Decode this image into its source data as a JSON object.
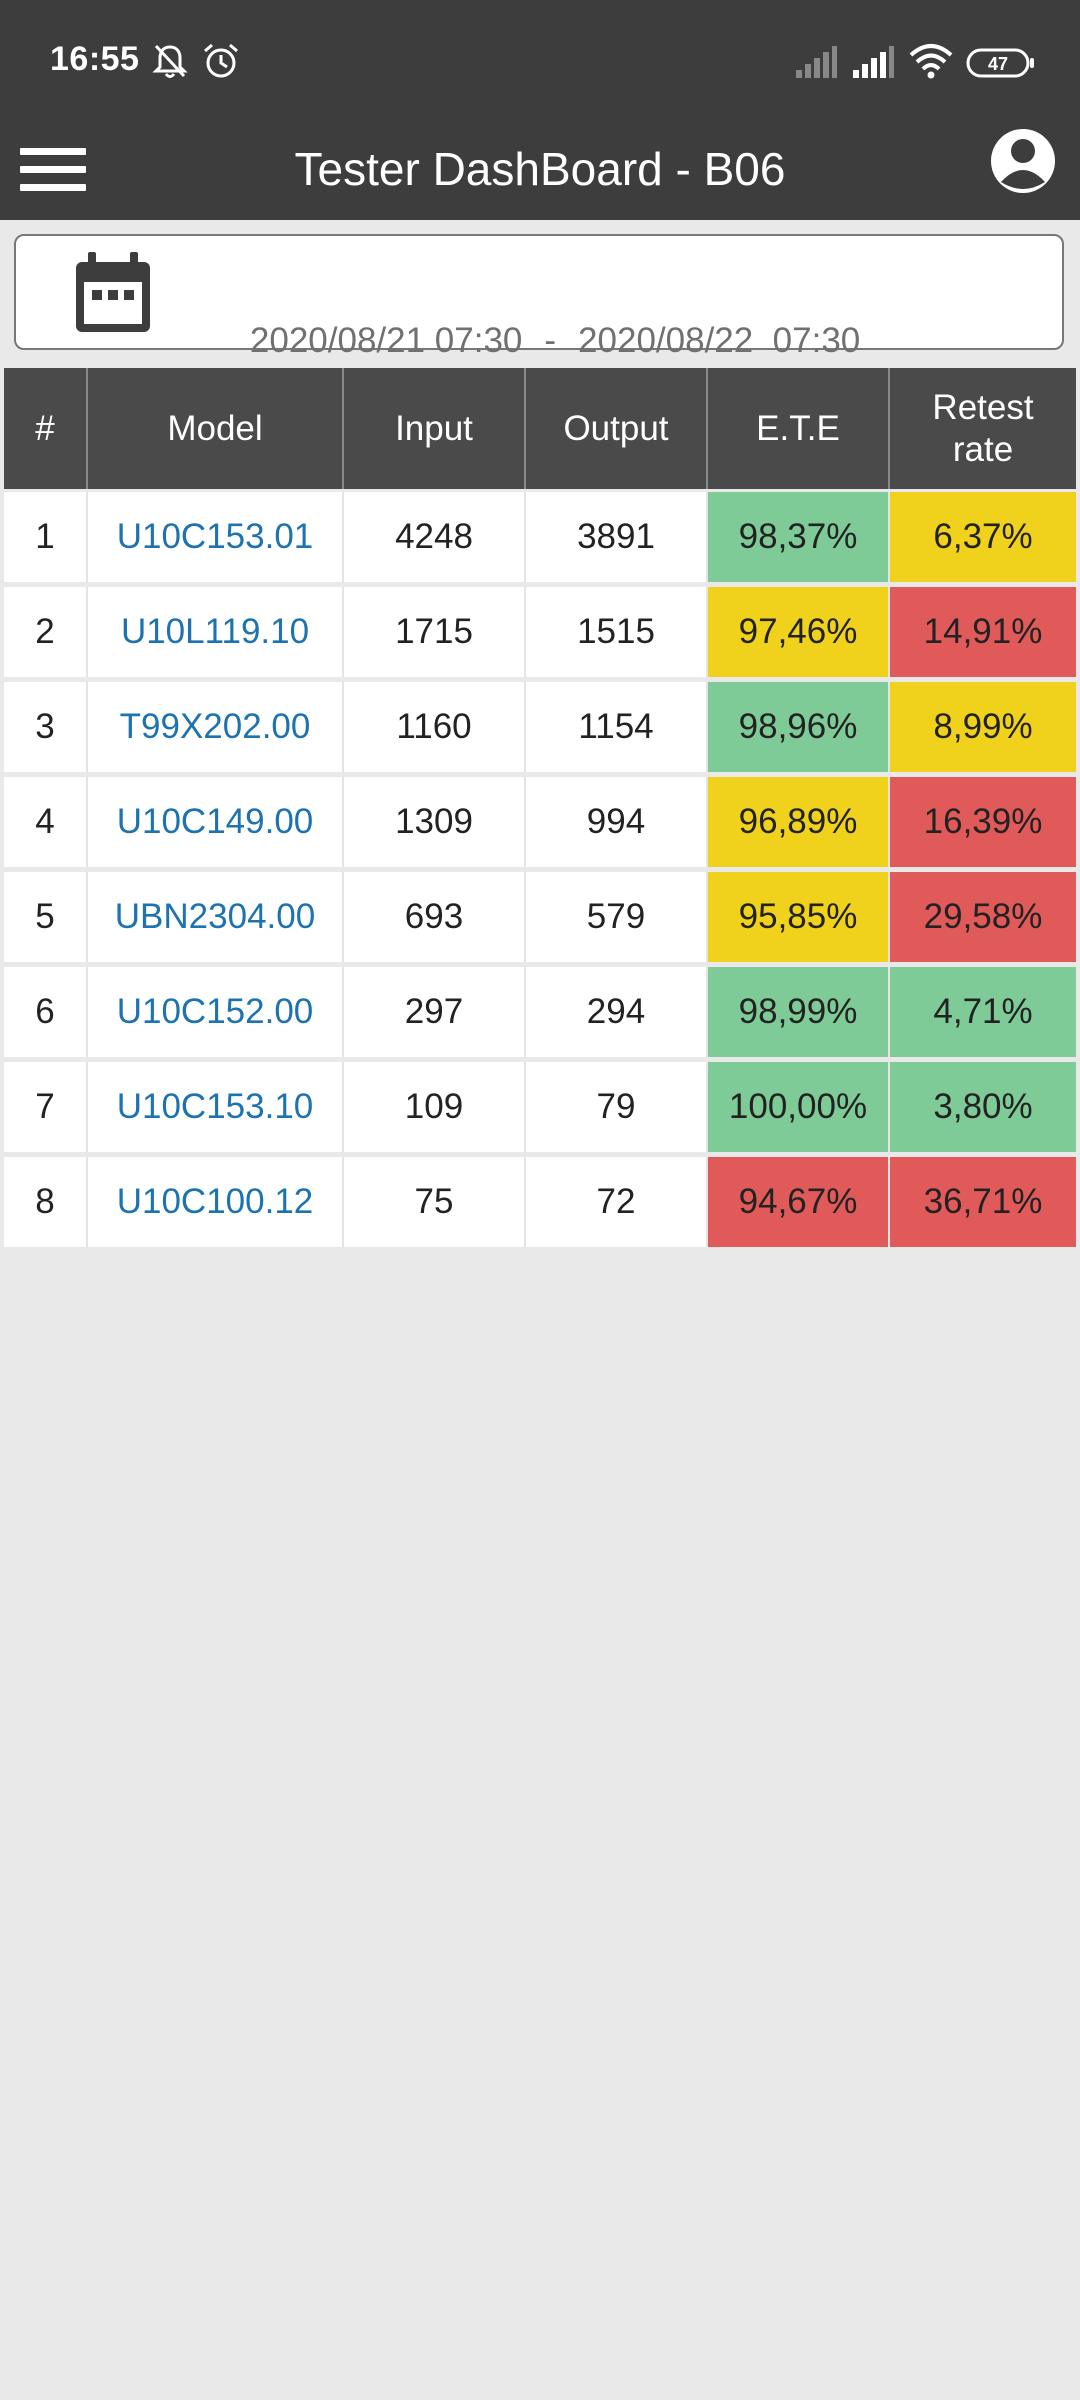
{
  "status_bar": {
    "time": "16:55",
    "battery": "47",
    "icons": [
      "bell-off-icon",
      "alarm-icon",
      "signal-icon",
      "signal-icon",
      "wifi-icon",
      "battery-icon"
    ]
  },
  "app_bar": {
    "title": "Tester DashBoard - B06",
    "menu_icon": "hamburger-icon",
    "profile_icon": "account-icon"
  },
  "date_range": {
    "icon": "calendar-icon",
    "start": "2020/08/21 07:30",
    "separator": "-",
    "end": "2020/08/22  07:30"
  },
  "table": {
    "headers": [
      "#",
      "Model",
      "Input",
      "Output",
      "E.T.E",
      "Retest\nrate"
    ],
    "rows": [
      {
        "no": "1",
        "model": "U10C153.01",
        "input": "4248",
        "output": "3891",
        "ete": "98,37%",
        "ete_status": "green",
        "retest": "6,37%",
        "retest_status": "yellow"
      },
      {
        "no": "2",
        "model": "U10L119.10",
        "input": "1715",
        "output": "1515",
        "ete": "97,46%",
        "ete_status": "yellow",
        "retest": "14,91%",
        "retest_status": "red"
      },
      {
        "no": "3",
        "model": "T99X202.00",
        "input": "1160",
        "output": "1154",
        "ete": "98,96%",
        "ete_status": "green",
        "retest": "8,99%",
        "retest_status": "yellow"
      },
      {
        "no": "4",
        "model": "U10C149.00",
        "input": "1309",
        "output": "994",
        "ete": "96,89%",
        "ete_status": "yellow",
        "retest": "16,39%",
        "retest_status": "red"
      },
      {
        "no": "5",
        "model": "UBN2304.00",
        "input": "693",
        "output": "579",
        "ete": "95,85%",
        "ete_status": "yellow",
        "retest": "29,58%",
        "retest_status": "red"
      },
      {
        "no": "6",
        "model": "U10C152.00",
        "input": "297",
        "output": "294",
        "ete": "98,99%",
        "ete_status": "green",
        "retest": "4,71%",
        "retest_status": "green"
      },
      {
        "no": "7",
        "model": "U10C153.10",
        "input": "109",
        "output": "79",
        "ete": "100,00%",
        "ete_status": "green",
        "retest": "3,80%",
        "retest_status": "green"
      },
      {
        "no": "8",
        "model": "U10C100.12",
        "input": "75",
        "output": "72",
        "ete": "94,67%",
        "ete_status": "red",
        "retest": "36,71%",
        "retest_status": "red"
      }
    ]
  },
  "colors": {
    "bar": "#3d3d3d",
    "header": "#4a4a4a",
    "green": "#7fcb97",
    "yellow": "#f0d21c",
    "red": "#e05a5a",
    "link": "#1d73b0",
    "background": "#e9e9e9"
  }
}
